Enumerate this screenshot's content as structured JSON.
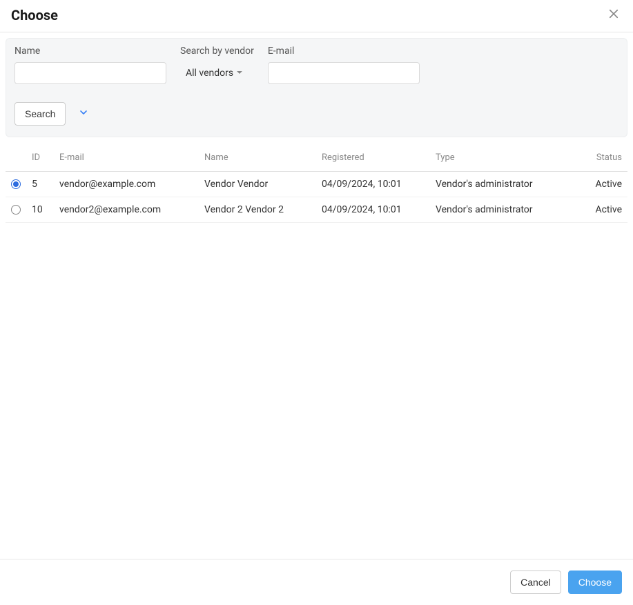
{
  "dialog": {
    "title": "Choose"
  },
  "filters": {
    "name_label": "Name",
    "name_value": "",
    "vendor_label": "Search by vendor",
    "vendor_selected": "All vendors",
    "email_label": "E-mail",
    "email_value": "",
    "search_button": "Search"
  },
  "table": {
    "headers": {
      "id": "ID",
      "email": "E-mail",
      "name": "Name",
      "registered": "Registered",
      "type": "Type",
      "status": "Status"
    },
    "rows": [
      {
        "selected": true,
        "id": "5",
        "email": "vendor@example.com",
        "name": "Vendor Vendor",
        "registered": "04/09/2024, 10:01",
        "type": "Vendor's administrator",
        "status": "Active"
      },
      {
        "selected": false,
        "id": "10",
        "email": "vendor2@example.com",
        "name": "Vendor 2 Vendor 2",
        "registered": "04/09/2024, 10:01",
        "type": "Vendor's administrator",
        "status": "Active"
      }
    ]
  },
  "footer": {
    "cancel": "Cancel",
    "choose": "Choose"
  }
}
